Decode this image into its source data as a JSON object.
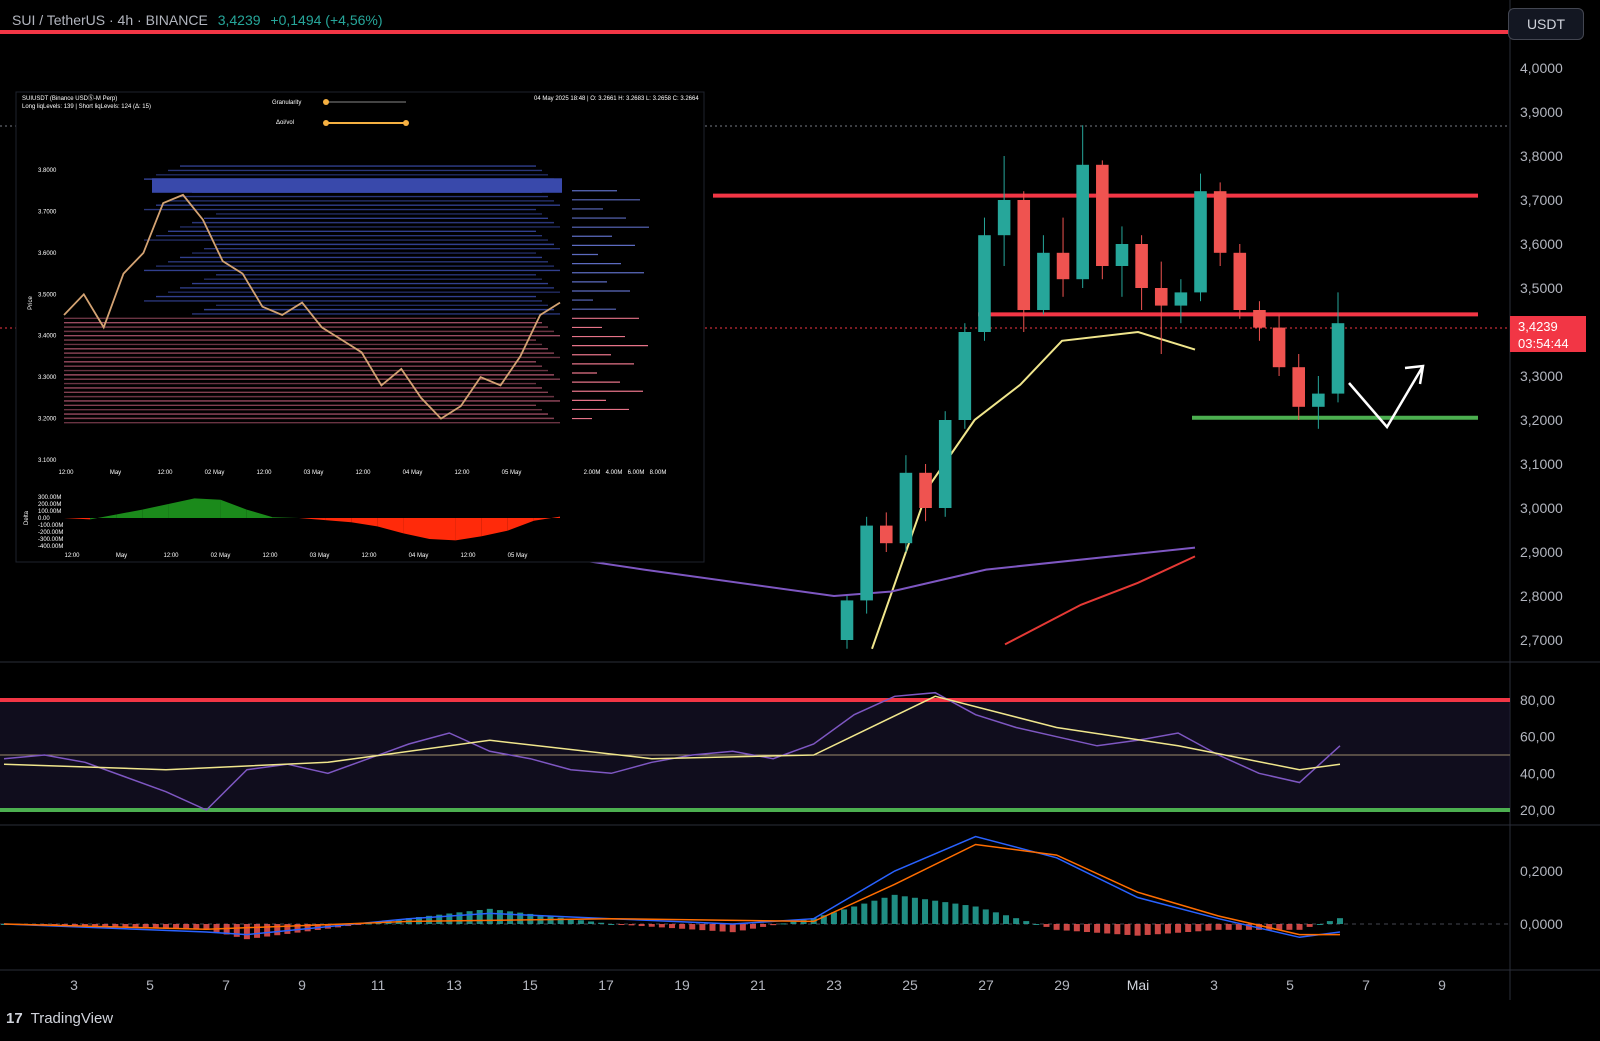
{
  "header": {
    "symbol": "SUI / TetherUS · 4h · BINANCE",
    "price": "3,4239",
    "change": "+0,1494 (+4,56%)"
  },
  "currency_button": "USDT",
  "price_tag": {
    "price": "3,4239",
    "countdown": "03:54:44"
  },
  "footer": {
    "logo_text": "TradingView"
  },
  "colors": {
    "up": "#26a69a",
    "down": "#ef5350",
    "resistance": "#f23645",
    "support": "#4caf50",
    "ema_fast": "#f0e68c",
    "ema_slow": "#7e57c2",
    "ema_long": "#e53935",
    "macd": "#2962ff",
    "signal": "#ff6d00"
  },
  "chart_data": [
    {
      "type": "candlestick",
      "name": "price",
      "x_ticks": [
        "3",
        "5",
        "7",
        "9",
        "11",
        "13",
        "15",
        "17",
        "19",
        "21",
        "23",
        "25",
        "27",
        "29",
        "Mai",
        "3",
        "5",
        "7",
        "9"
      ],
      "y_ticks": [
        "4,0000",
        "3,9000",
        "3,8000",
        "3,7000",
        "3,6000",
        "3,5000",
        "3,3000",
        "3,2000",
        "3,1000",
        "3,0000",
        "2,9000",
        "2,8000",
        "2,7000"
      ],
      "ylim": [
        2.69,
        4.02
      ],
      "horizontal_levels": [
        {
          "role": "resistance",
          "value": 4.08
        },
        {
          "role": "resistance",
          "value": 3.71
        },
        {
          "role": "resistance",
          "value": 3.44
        },
        {
          "role": "support",
          "value": 3.205
        }
      ],
      "candles_ohlc": [
        [
          2.7,
          2.8,
          2.68,
          2.79
        ],
        [
          2.79,
          2.98,
          2.76,
          2.96
        ],
        [
          2.96,
          2.99,
          2.9,
          2.92
        ],
        [
          2.92,
          3.12,
          2.9,
          3.08
        ],
        [
          3.08,
          3.1,
          2.97,
          3.0
        ],
        [
          3.0,
          3.22,
          2.98,
          3.2
        ],
        [
          3.2,
          3.42,
          3.18,
          3.4
        ],
        [
          3.4,
          3.66,
          3.38,
          3.62
        ],
        [
          3.62,
          3.8,
          3.55,
          3.7
        ],
        [
          3.7,
          3.72,
          3.4,
          3.45
        ],
        [
          3.45,
          3.62,
          3.44,
          3.58
        ],
        [
          3.58,
          3.66,
          3.48,
          3.52
        ],
        [
          3.52,
          3.87,
          3.5,
          3.78
        ],
        [
          3.78,
          3.79,
          3.52,
          3.55
        ],
        [
          3.55,
          3.64,
          3.48,
          3.6
        ],
        [
          3.6,
          3.62,
          3.45,
          3.5
        ],
        [
          3.5,
          3.56,
          3.35,
          3.46
        ],
        [
          3.46,
          3.52,
          3.42,
          3.49
        ],
        [
          3.49,
          3.76,
          3.47,
          3.72
        ],
        [
          3.72,
          3.74,
          3.55,
          3.58
        ],
        [
          3.58,
          3.6,
          3.43,
          3.45
        ],
        [
          3.45,
          3.47,
          3.38,
          3.41
        ],
        [
          3.41,
          3.44,
          3.3,
          3.32
        ],
        [
          3.32,
          3.35,
          3.2,
          3.23
        ],
        [
          3.23,
          3.3,
          3.18,
          3.26
        ],
        [
          3.26,
          3.49,
          3.24,
          3.42
        ]
      ],
      "moving_averages": [
        {
          "role": "fast",
          "points": [
            [
              24.0,
              2.68
            ],
            [
              25.5,
              3.05
            ],
            [
              26.7,
              3.2
            ],
            [
              27.9,
              3.28
            ],
            [
              29.0,
              3.38
            ],
            [
              31.0,
              3.4
            ],
            [
              32.5,
              3.36
            ]
          ]
        },
        {
          "role": "slow",
          "points": [
            [
              4.0,
              3.13
            ],
            [
              11.0,
              2.95
            ],
            [
              18.0,
              2.86
            ],
            [
              23.0,
              2.8
            ],
            [
              24.5,
              2.81
            ],
            [
              27.0,
              2.86
            ],
            [
              32.5,
              2.91
            ]
          ]
        },
        {
          "role": "long",
          "points": [
            [
              27.5,
              2.69
            ],
            [
              29.5,
              2.78
            ],
            [
              31.0,
              2.83
            ],
            [
              32.5,
              2.89
            ]
          ]
        }
      ]
    },
    {
      "type": "line",
      "name": "rsi",
      "y_ticks": [
        "80,00",
        "60,00",
        "40,00",
        "20,00"
      ],
      "ylim": [
        12,
        98
      ],
      "levels": [
        80,
        50,
        20
      ],
      "series": [
        {
          "role": "rsi",
          "x": [
            0,
            1,
            2,
            3,
            4,
            5,
            6,
            7,
            8,
            9,
            10,
            11,
            12,
            13,
            14,
            15,
            16,
            17,
            18,
            19,
            20,
            21,
            22,
            23,
            24,
            25,
            26,
            27,
            28,
            29,
            30,
            31,
            32,
            33
          ],
          "y": [
            48,
            50,
            46,
            38,
            30,
            20,
            42,
            45,
            40,
            48,
            56,
            62,
            52,
            48,
            42,
            40,
            46,
            50,
            52,
            48,
            56,
            72,
            82,
            84,
            72,
            65,
            60,
            55,
            58,
            62,
            50,
            40,
            35,
            55
          ]
        },
        {
          "role": "signal",
          "x": [
            0,
            4,
            8,
            12,
            16,
            20,
            23,
            26,
            29,
            32,
            33
          ],
          "y": [
            45,
            42,
            46,
            58,
            48,
            50,
            82,
            65,
            55,
            42,
            45
          ]
        }
      ]
    },
    {
      "type": "macd",
      "name": "macd",
      "y_ticks": [
        "0,2000",
        "0,0000"
      ],
      "ylim": [
        -0.08,
        0.34
      ],
      "series": [
        {
          "role": "macd",
          "x": [
            0,
            5,
            6,
            10,
            12,
            15,
            18,
            20,
            22,
            24,
            26,
            28,
            30,
            32,
            33
          ],
          "y": [
            0.0,
            -0.03,
            -0.04,
            0.02,
            0.04,
            0.02,
            0.0,
            0.02,
            0.2,
            0.33,
            0.25,
            0.1,
            0.02,
            -0.05,
            -0.03
          ]
        },
        {
          "role": "signal",
          "x": [
            0,
            5,
            10,
            15,
            20,
            22,
            24,
            26,
            28,
            30,
            32,
            33
          ],
          "y": [
            0.0,
            -0.02,
            0.01,
            0.02,
            0.01,
            0.15,
            0.3,
            0.26,
            0.12,
            0.03,
            -0.04,
            -0.04
          ]
        }
      ]
    },
    {
      "type": "heatmap",
      "name": "liquidation-levels-inset",
      "info_line_1": "SUIUSDT (Binance USDⓈ-M Perp)",
      "info_line_2": "Long liqLevels: 139 | Short liqLevels: 124 (Δ: 15)",
      "ohlc_info": "04 May 2025 18:48 | O: 3.2661 H: 3.2683 L: 3.2658 C: 3.2664",
      "slider_labels": [
        "Granularity",
        "Δoi/vol"
      ],
      "price_axis_label": "Price",
      "price_ticks": [
        "3.8000",
        "3.7000",
        "3.6000",
        "3.5000",
        "3.4000",
        "3.3000",
        "3.2000",
        "3.1000"
      ],
      "time_ticks": [
        "12:00",
        "May",
        "12:00",
        "02 May",
        "12:00",
        "03 May",
        "12:00",
        "04 May",
        "12:00",
        "05 May"
      ],
      "volume_ticks": [
        "2.00M",
        "4.00M",
        "6.00M",
        "8.00M"
      ],
      "delta_axis_label": "Delta",
      "delta_ticks": [
        "300.00M",
        "200.00M",
        "100.00M",
        "0.00",
        "-100.00M",
        "-200.00M",
        "-300.00M",
        "-400.00M"
      ],
      "price_path": [
        3.45,
        3.5,
        3.42,
        3.55,
        3.6,
        3.72,
        3.74,
        3.68,
        3.58,
        3.55,
        3.47,
        3.45,
        3.48,
        3.42,
        3.39,
        3.36,
        3.28,
        3.32,
        3.25,
        3.2,
        3.23,
        3.3,
        3.28,
        3.35,
        3.45,
        3.48
      ],
      "delta_path": [
        0,
        -20,
        50,
        120,
        200,
        280,
        260,
        120,
        10,
        0,
        -30,
        -60,
        -120,
        -220,
        -300,
        -320,
        -260,
        -180,
        -40,
        20
      ]
    }
  ]
}
